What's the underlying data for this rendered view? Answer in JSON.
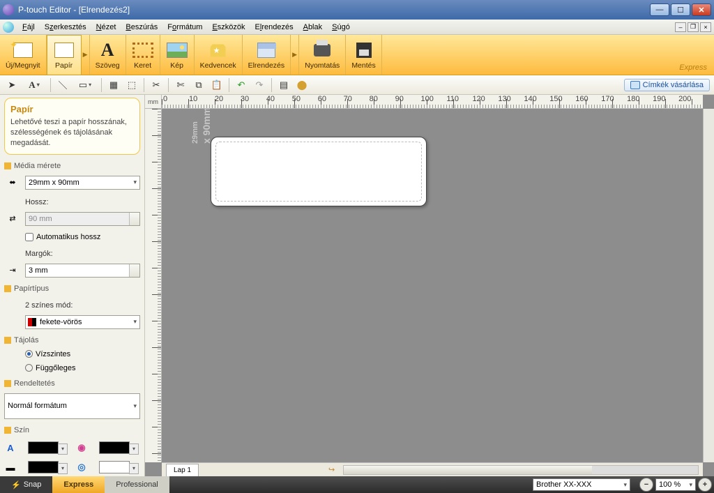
{
  "window": {
    "title": "P-touch Editor - [Elrendezés2]"
  },
  "menu": {
    "items": [
      "Fájl",
      "Szerkesztés",
      "Nézet",
      "Beszúrás",
      "Formátum",
      "Eszközök",
      "Elrendezés",
      "Ablak",
      "Súgó"
    ]
  },
  "ribbon": {
    "new_open": "Új/Megnyit",
    "paper": "Papír",
    "text": "Szöveg",
    "frame": "Keret",
    "image": "Kép",
    "favorites": "Kedvencek",
    "layout": "Elrendezés",
    "print": "Nyomtatás",
    "save": "Mentés",
    "mode": "Express"
  },
  "toolbar2": {
    "buy_labels": "Címkék vásárlása"
  },
  "side": {
    "title": "Papír",
    "desc": "Lehetővé teszi a papír hosszának, szélességének és tájolásának megadását.",
    "media_size": "Média mérete",
    "media_value": "29mm x 90mm",
    "length_lbl": "Hossz:",
    "length_val": "90 mm",
    "auto_len": "Automatikus hossz",
    "margins_lbl": "Margók:",
    "margins_val": "3 mm",
    "paper_type": "Papírtípus",
    "two_color": "2 színes mód:",
    "two_color_val": "fekete-vörös",
    "orient": "Tájolás",
    "landscape": "Vízszintes",
    "portrait": "Függőleges",
    "purpose": "Rendeltetés",
    "purpose_val": "Normál formátum",
    "color": "Szín"
  },
  "canvas": {
    "unit": "mm",
    "size_l1": "29mm",
    "size_l2": "x 90mm",
    "sheet": "Lap 1",
    "h_ticks": [
      "0",
      "10",
      "20",
      "30",
      "40",
      "50",
      "60",
      "70",
      "80",
      "90",
      "100",
      "110",
      "120",
      "130",
      "140",
      "150",
      "160",
      "170",
      "180",
      "190",
      "200"
    ]
  },
  "status": {
    "snap": "Snap",
    "express": "Express",
    "professional": "Professional",
    "printer": "Brother XX-XXX",
    "zoom": "100 %"
  }
}
